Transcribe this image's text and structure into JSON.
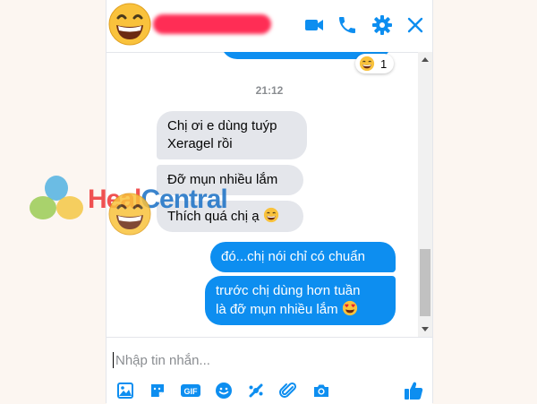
{
  "colors": {
    "accent": "#0d8ef0",
    "incoming_bubble": "#e4e6eb",
    "redaction": "#ff2d55",
    "time_text": "#8a8d91",
    "watermark_red": "#ee3b3b",
    "watermark_blue": "#1f74c7"
  },
  "header": {
    "avatar_icon": "grinning-emoji-avatar",
    "name_redacted": true,
    "actions": [
      "video-call-icon",
      "phone-icon",
      "gear-icon",
      "close-icon"
    ]
  },
  "messages": {
    "reaction": {
      "emoji": "grinning-emoji",
      "count": "1"
    },
    "timestamp": "21:12",
    "incoming": [
      {
        "line1": "Chị ơi e dùng tuýp",
        "line2": "Xeragel rồi"
      },
      {
        "text": "Đỡ mụn nhiều lắm"
      },
      {
        "text": "Thích quá chị ạ",
        "emoji": "grinning-emoji"
      }
    ],
    "outgoing": [
      {
        "text": "đó...chị nói chỉ có chuẩn"
      },
      {
        "line1": "trước chị dùng hơn tuần",
        "line2": "là đỡ mụn nhiều lắm",
        "emoji": "heart-eyes-emoji"
      }
    ]
  },
  "composer": {
    "placeholder": "Nhập tin nhắn...",
    "value": "",
    "toolbar": [
      "image-icon",
      "sticker-icon",
      "gif-icon",
      "emoji-icon",
      "game-icon",
      "attach-icon",
      "camera-icon"
    ],
    "like_icon": "thumbs-up-icon",
    "gif_label": "GIF"
  },
  "watermark": {
    "part1": "Heal",
    "part2": "Central"
  }
}
